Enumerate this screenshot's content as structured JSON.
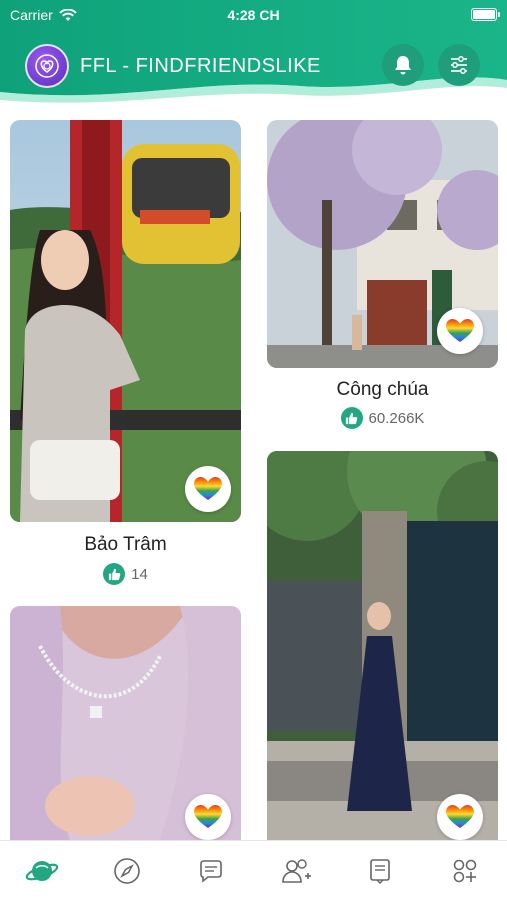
{
  "status_bar": {
    "carrier": "Carrier",
    "time": "4:28 CH"
  },
  "header": {
    "title": "FFL - FINDFRIENDSLIKE"
  },
  "colors": {
    "brand": "#12a57d",
    "accent": "#21a882",
    "text": "#222222"
  },
  "profiles": [
    {
      "name": "Bảo Trâm",
      "likes": "14"
    },
    {
      "name": "Công chúa",
      "likes": "60.266K"
    },
    {
      "name": "",
      "likes": ""
    },
    {
      "name": "",
      "likes": ""
    }
  ],
  "tabs": [
    {
      "icon": "planet-icon",
      "active": true
    },
    {
      "icon": "compass-icon",
      "active": false
    },
    {
      "icon": "chat-icon",
      "active": false
    },
    {
      "icon": "add-friend-icon",
      "active": false
    },
    {
      "icon": "notes-icon",
      "active": false
    },
    {
      "icon": "more-apps-icon",
      "active": false
    }
  ]
}
